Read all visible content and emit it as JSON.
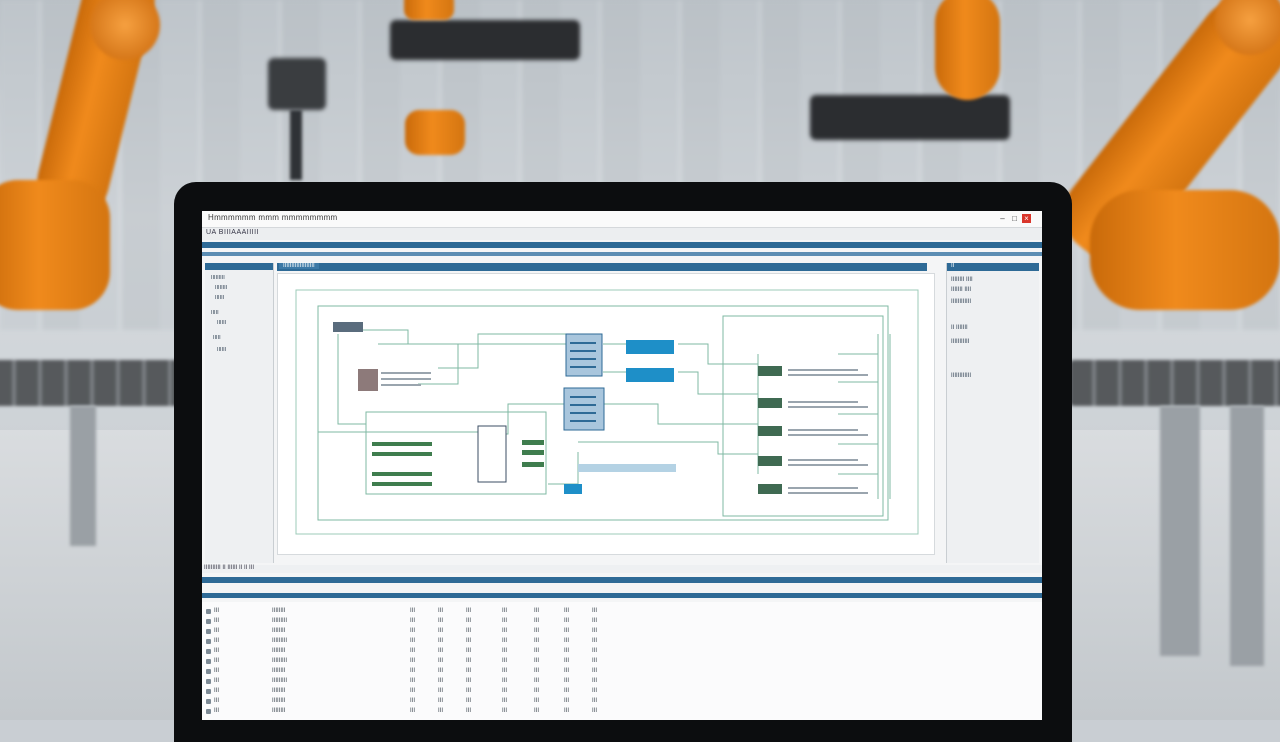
{
  "window": {
    "title": "Hmmmmmm mmm mmmmmmmm",
    "min_icon": "minimize-icon",
    "close_icon": "close-icon"
  },
  "menubar": {
    "text": "UA  BIIIAAAIIIII"
  },
  "left_panel": {
    "items": [
      "IIIIIIIII",
      "IIIIIIII",
      "IIIIII",
      "IIIII",
      "IIIIII",
      "IIIII",
      "IIIIII"
    ]
  },
  "canvas": {
    "tab_label": "IIIIIIIIIIIIIIIIIII"
  },
  "right_panel": {
    "title": "II",
    "items": [
      "IIIIIIII IIII",
      "IIIIIII IIII",
      "IIIIIIIIIIII",
      "II IIIIIII",
      "IIIIIIIIIII",
      "IIIIIIIIIIII"
    ]
  },
  "bottom_toolbar": {
    "text": "IIIIIIIIII  II  IIIIII  II  II  III"
  },
  "table": {
    "rows": [
      [
        "III",
        "IIIIIIII",
        "III",
        "III",
        "III",
        "III",
        "III",
        "III",
        "III"
      ],
      [
        "III",
        "IIIIIIIII",
        "III",
        "III",
        "III",
        "III",
        "III",
        "III",
        "III"
      ],
      [
        "III",
        "IIIIIIII",
        "III",
        "III",
        "III",
        "III",
        "III",
        "III",
        "III"
      ],
      [
        "III",
        "IIIIIIIII",
        "III",
        "III",
        "III",
        "III",
        "III",
        "III",
        "III"
      ],
      [
        "III",
        "IIIIIIII",
        "III",
        "III",
        "III",
        "III",
        "III",
        "III",
        "III"
      ],
      [
        "III",
        "IIIIIIIII",
        "III",
        "III",
        "III",
        "III",
        "III",
        "III",
        "III"
      ],
      [
        "III",
        "IIIIIIII",
        "III",
        "III",
        "III",
        "III",
        "III",
        "III",
        "III"
      ],
      [
        "III",
        "IIIIIIIII",
        "III",
        "III",
        "III",
        "III",
        "III",
        "III",
        "III"
      ],
      [
        "III",
        "IIIIIIII",
        "III",
        "III",
        "III",
        "III",
        "III",
        "III",
        "III"
      ],
      [
        "III",
        "IIIIIIII",
        "III",
        "III",
        "III",
        "III",
        "III",
        "III",
        "III"
      ],
      [
        "III",
        "IIIIIIII",
        "III",
        "III",
        "III",
        "III",
        "III",
        "III",
        "III"
      ]
    ]
  },
  "colors": {
    "accent": "#2e6a96",
    "diagram_line": "#5aa88a",
    "block_blue": "#1e8fc8",
    "block_green": "#3f7d4e"
  }
}
